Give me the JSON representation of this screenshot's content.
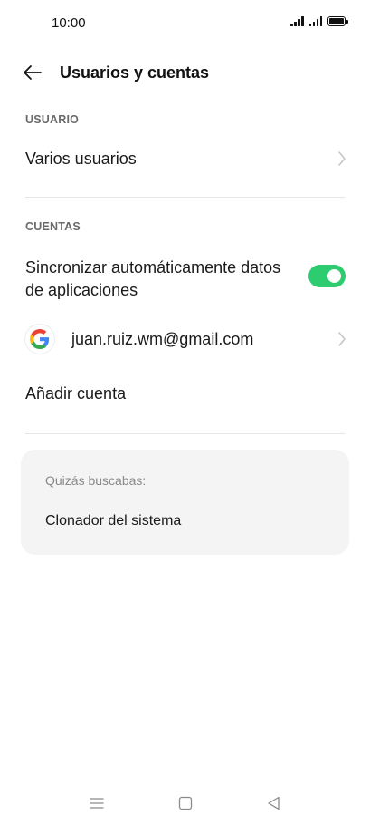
{
  "status_bar": {
    "time": "10:00"
  },
  "header": {
    "title": "Usuarios y cuentas"
  },
  "section_user": {
    "label": "USUARIO",
    "multiple_users_label": "Varios usuarios"
  },
  "section_accounts": {
    "label": "CUENTAS",
    "sync_label": "Sincronizar automáticamente datos de aplicaciones",
    "sync_enabled": true,
    "account_email": "juan.ruiz.wm@gmail.com",
    "add_account_label": "Añadir cuenta"
  },
  "suggestions": {
    "heading": "Quizás buscabas:",
    "item": "Clonador del sistema"
  },
  "colors": {
    "toggle_on": "#2ecc71",
    "card_bg": "#f4f4f4",
    "section_label": "#6b6b6b"
  },
  "icons": {
    "back": "arrow-left-icon",
    "chevron": "chevron-right-icon",
    "google": "google-icon",
    "nav_menu": "menu-icon",
    "nav_home": "home-icon",
    "nav_back": "back-triangle-icon"
  }
}
